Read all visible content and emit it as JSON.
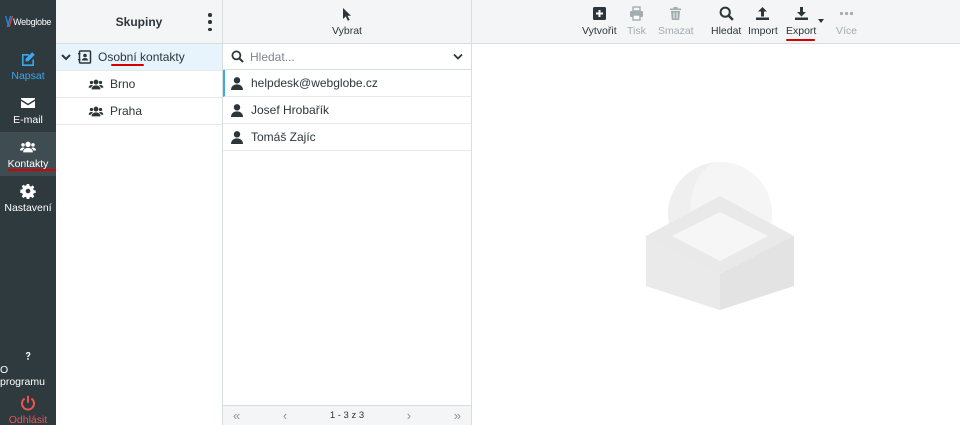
{
  "brand": {
    "logo_text": "Webglobe"
  },
  "nav": {
    "compose": "Napsat",
    "mail": "E-mail",
    "contacts": "Kontakty",
    "settings": "Nastavení",
    "about": "O programu",
    "logout": "Odhlásit"
  },
  "groups": {
    "header": "Skupiny",
    "items": [
      {
        "label": "Osobní kontakty"
      },
      {
        "label": "Brno"
      },
      {
        "label": "Praha"
      }
    ]
  },
  "list": {
    "select_label": "Vybrat",
    "search_placeholder": "Hledat...",
    "contacts": [
      {
        "name": "helpdesk@webglobe.cz"
      },
      {
        "name": "Josef Hrobařík"
      },
      {
        "name": "Tomáš Zajíc"
      }
    ],
    "pagination": "1 - 3 z 3"
  },
  "toolbar": {
    "create": "Vytvořit",
    "print": "Tisk",
    "delete": "Smazat",
    "search": "Hledat",
    "import": "Import",
    "export": "Export",
    "more": "Více"
  },
  "colors": {
    "nav_bg": "#2f3a3f",
    "accent": "#3ea6ec",
    "logout": "#ef5350",
    "annotation_underline": "#d50000"
  }
}
